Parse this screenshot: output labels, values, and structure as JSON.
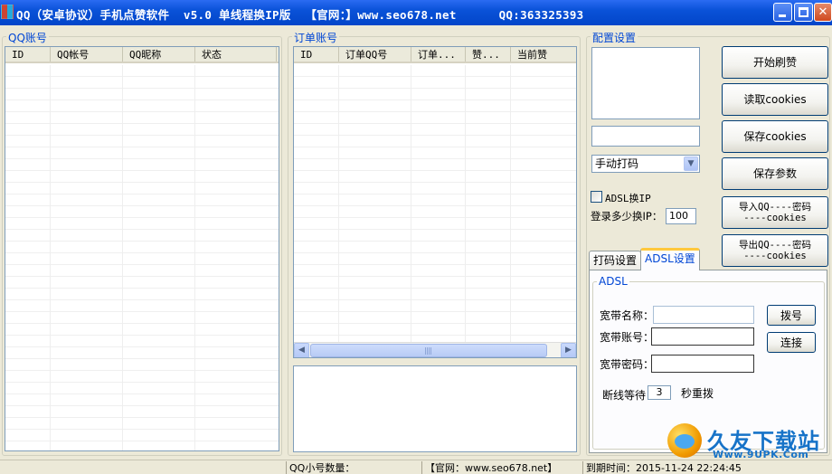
{
  "window": {
    "title": "QQ（安卓协议）手机点赞软件  v5.0 单线程换IP版  【官网：】www.seo678.net      QQ:363325393"
  },
  "qq_accounts": {
    "group_title": "QQ账号",
    "columns": [
      "ID",
      "QQ帐号",
      "QQ昵称",
      "状态"
    ]
  },
  "orders": {
    "group_title": "订单账号",
    "columns": [
      "ID",
      "订单QQ号",
      "订单...",
      "赞...",
      "当前赞"
    ]
  },
  "config": {
    "group_title": "配置设置",
    "captcha_mode": "手动打码",
    "adsl_checkbox_label": "ADSL换IP",
    "ip_switch_label": "登录多少换IP：",
    "ip_switch_value": "100",
    "buttons": {
      "start": "开始刷赞",
      "read_cookies": "读取cookies",
      "save_cookies": "保存cookies",
      "save_params": "保存参数",
      "import_line1": "导入QQ----密码",
      "import_line2": "----cookies",
      "export_line1": "导出QQ----密码",
      "export_line2": "----cookies"
    },
    "tabs": [
      "打码设置",
      "ADSL设置"
    ],
    "adsl": {
      "group_title": "ADSL",
      "name_label": "宽带名称：",
      "account_label": "宽带账号：",
      "password_label": "宽带密码：",
      "dial_button": "拨号",
      "connect_button": "连接",
      "wait_label": "断线等待",
      "wait_value": "3",
      "wait_unit": "秒重拨"
    }
  },
  "status": {
    "qq_count_label": "QQ小号数量：",
    "site": "【官网：www.seo678.net】",
    "expire": "到期时间：2015-11-24 22:24:45"
  },
  "watermark": {
    "text": "久友下载站",
    "url": "Www.9UPK.Com"
  }
}
